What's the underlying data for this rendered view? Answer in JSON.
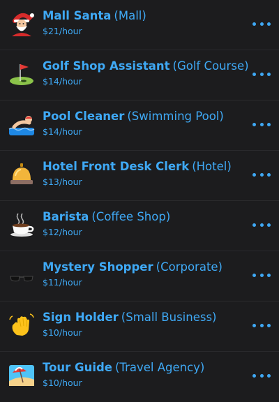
{
  "jobs": [
    {
      "title": "Mall Santa",
      "place": "(Mall)",
      "wage": "$21/hour",
      "icon": "santa-icon"
    },
    {
      "title": "Golf Shop Assistant",
      "place": "(Golf Course)",
      "wage": "$14/hour",
      "icon": "golf-flag-icon"
    },
    {
      "title": "Pool Cleaner",
      "place": "(Swimming Pool)",
      "wage": "$14/hour",
      "icon": "swimmer-icon"
    },
    {
      "title": "Hotel Front Desk Clerk",
      "place": "(Hotel)",
      "wage": "$13/hour",
      "icon": "bellhop-bell-icon"
    },
    {
      "title": "Barista",
      "place": "(Coffee Shop)",
      "wage": "$12/hour",
      "icon": "coffee-cup-icon"
    },
    {
      "title": "Mystery Shopper",
      "place": "(Corporate)",
      "wage": "$11/hour",
      "icon": "sunglasses-icon"
    },
    {
      "title": "Sign Holder",
      "place": "(Small Business)",
      "wage": "$10/hour",
      "icon": "waving-hand-icon"
    },
    {
      "title": "Tour Guide",
      "place": "(Travel Agency)",
      "wage": "$10/hour",
      "icon": "beach-umbrella-icon"
    }
  ],
  "colors": {
    "background": "#1c1c1e",
    "accent": "#3fa9f5",
    "divider": "#2a2a2d"
  }
}
